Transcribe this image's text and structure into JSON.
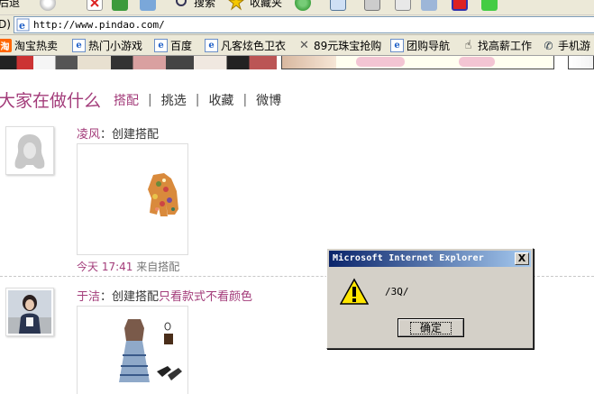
{
  "toolbar": {
    "left_label": "后退",
    "search_label": "搜索",
    "favorites_label": "收藏夹"
  },
  "address_bar": {
    "label": "D)",
    "url": "http://www.pindao.com/"
  },
  "links_bar": {
    "items": [
      {
        "label": "淘宝热卖",
        "icon": "taobao-icon"
      },
      {
        "label": "热门小游戏",
        "icon": "ie-page-icon"
      },
      {
        "label": "百度",
        "icon": "ie-page-icon"
      },
      {
        "label": "凡客炫色卫衣",
        "icon": "ie-page-icon"
      },
      {
        "label": "89元珠宝抢购",
        "icon": "x-logo-icon"
      },
      {
        "label": "团购导航",
        "icon": "ie-page-icon"
      },
      {
        "label": "找高薪工作",
        "icon": "hand-icon"
      },
      {
        "label": "手机游",
        "icon": "phone-icon"
      }
    ]
  },
  "page": {
    "heading": "大家在做什么",
    "tabs": [
      {
        "label": "搭配",
        "active": true
      },
      {
        "label": "挑选",
        "active": false
      },
      {
        "label": "收藏",
        "active": false
      },
      {
        "label": "微博",
        "active": false
      }
    ],
    "feed": [
      {
        "user": "凌风",
        "colon": "：",
        "action": "创建搭配",
        "extra": "",
        "time": "今天 17:41",
        "source": "来自搭配"
      },
      {
        "user": "于洁",
        "colon": "：",
        "action": "创建搭配",
        "extra": "只看款式不看颜色"
      }
    ]
  },
  "dialog": {
    "title": "Microsoft Internet Explorer",
    "message": "/3Q/",
    "ok_label": "确定",
    "close_glyph": "X"
  },
  "colors": {
    "accent": "#a33c7a",
    "dialog_bg": "#d4d0c8",
    "titlebar": "#0a246a"
  }
}
